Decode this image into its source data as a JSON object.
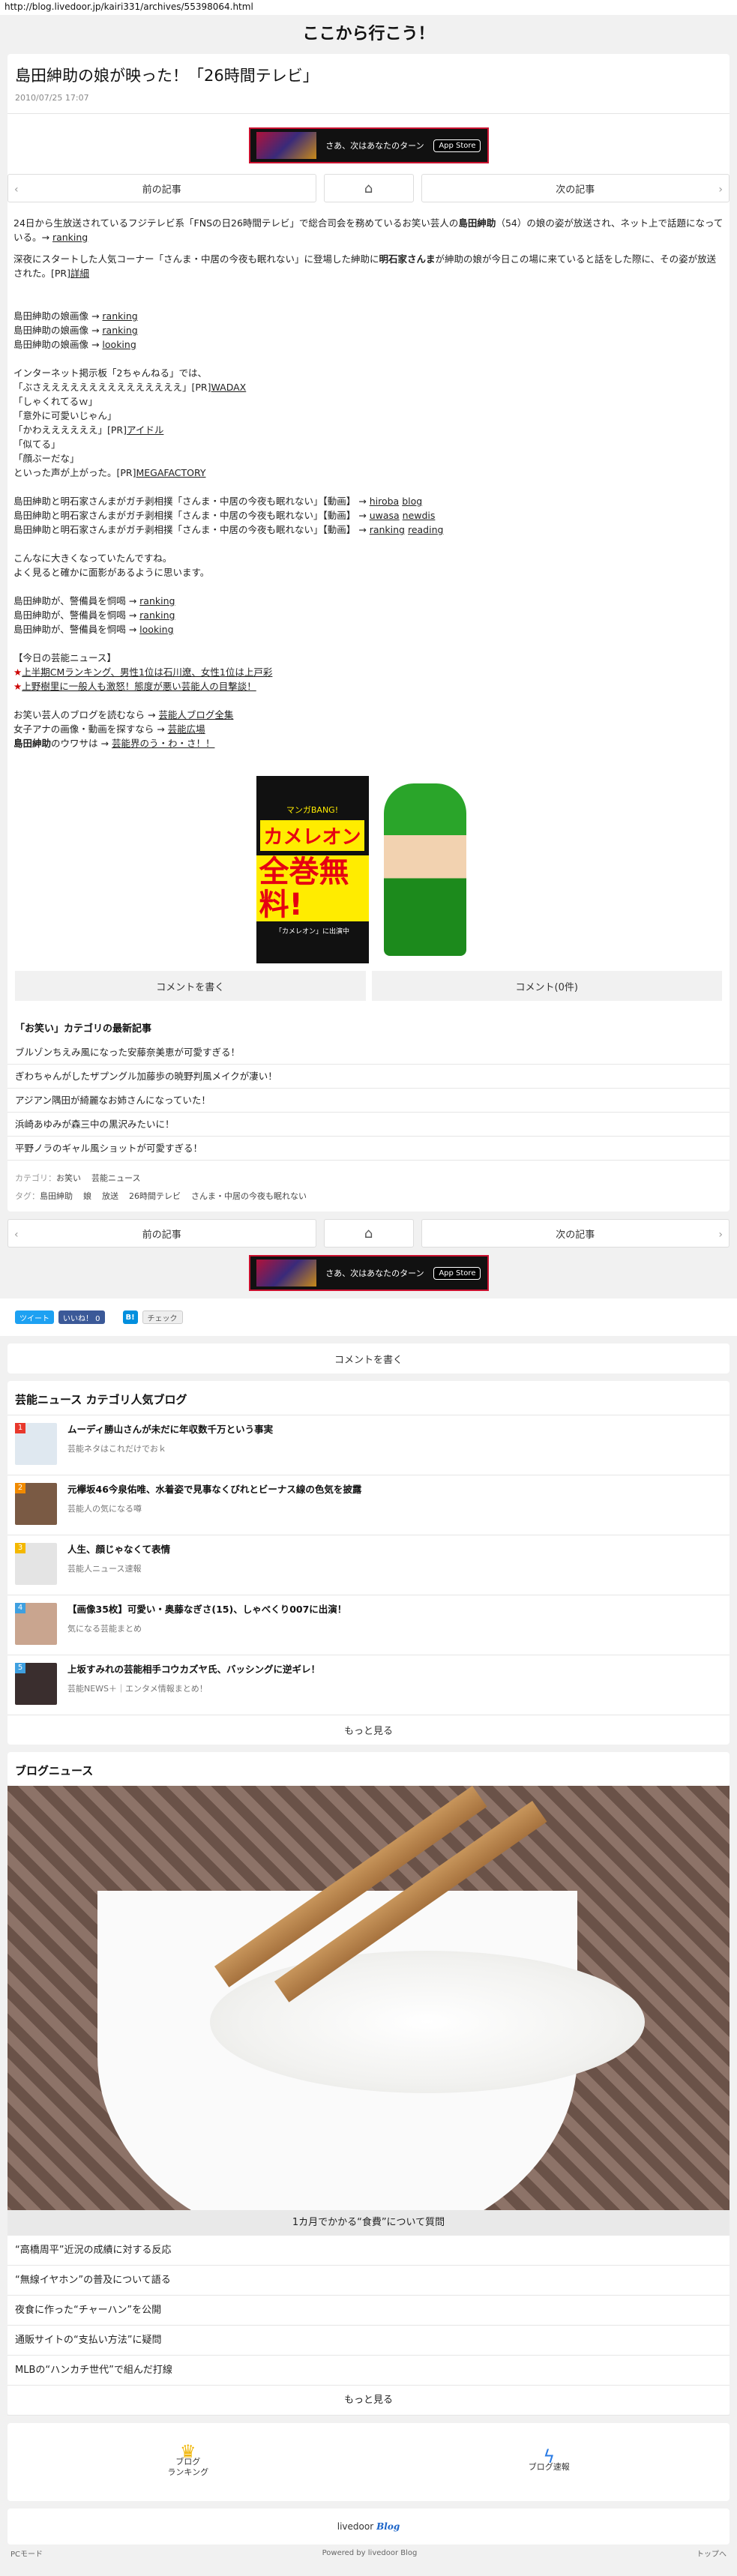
{
  "browser": {
    "url": "http://blog.livedoor.jp/kairi331/archives/55398064.html"
  },
  "site": {
    "title": "ここから行こう！"
  },
  "article": {
    "title": "島田紳助の娘が映った！「26時間テレビ」",
    "date": "2010/07/25 17:07"
  },
  "banner": {
    "text": "さあ、次はあなたのターン",
    "store": "App Store"
  },
  "pager": {
    "prev": "前の記事",
    "next": "次の記事"
  },
  "body": {
    "p1a": "24日から生放送されているフジテレビ系「FNSの日26時間テレビ」で総合司会を務めているお笑い芸人の",
    "p1b": "島田紳助",
    "p1c": "（54）の娘の姿が放送され、ネット上で話題になっている。→ ",
    "p1link": "ranking",
    "p2a": "深夜にスタートした人気コーナー「さんま・中居の今夜も眠れない」に登場した紳助に",
    "p2b": "明石家さんま",
    "p2c": "が紳助の娘が今日この場に来ていると話をした際に、その姿が放送された。[PR]",
    "p2link": "詳細",
    "img1": "島田紳助の娘画像 → ",
    "img1link": "ranking",
    "img2": "島田紳助の娘画像 → ",
    "img2link": "ranking",
    "img3": "島田紳助の娘画像 → ",
    "img3link": "looking",
    "net1": "インターネット掲示板「2ちゃんねる」では、",
    "net2a": "「ぶさえええええええええええええええ」[PR]",
    "net2link": "WADAX",
    "net3": "「しゃくれてるｗ」",
    "net4": "「意外に可愛いじゃん」",
    "net5a": "「かわええええええ」[PR]",
    "net5link": "アイドル",
    "net6": "「似てる」",
    "net7": "「顔ぶーだな」",
    "net8a": "といった声が上がった。[PR]",
    "net8link": "MEGAFACTORY",
    "v1": "島田紳助と明石家さんまがガチ剥相撲「さんま・中居の今夜も眠れない」【動画】 → ",
    "v1linkA": "hiroba",
    "v1linkB": "blog",
    "v2": "島田紳助と明石家さんまがガチ剥相撲「さんま・中居の今夜も眠れない」【動画】 → ",
    "v2linkA": "uwasa",
    "v2linkB": "newdis",
    "v3": "島田紳助と明石家さんまがガチ剥相撲「さんま・中居の今夜も眠れない」【動画】 → ",
    "v3linkA": "ranking",
    "v3linkB": "reading",
    "c1": "こんなに大きくなっていたんですね。",
    "c2": "よく見ると確かに面影があるように思います。",
    "g1": "島田紳助が、警備員を恫喝 → ",
    "g1link": "ranking",
    "g2": "島田紳助が、警備員を恫喝 → ",
    "g2link": "ranking",
    "g3": "島田紳助が、警備員を恫喝 → ",
    "g3link": "looking",
    "today_head": "【今日の芸能ニュース】",
    "today1": "上半期CMランキング、男性1位は石川遼、女性1位は上戸彩",
    "today2": "上野樹里に一般人も激怒！態度が悪い芸能人の目撃談！",
    "f1a": "お笑い芸人のブログを読むなら → ",
    "f1link": "芸能人ブログ全集",
    "f2a": "女子アナの画像・動画を探すなら → ",
    "f2link": "芸能広場",
    "f3a": "島田紳助",
    "f3b": "のウワサは → ",
    "f3link": "芸能界のう・わ・さ！！"
  },
  "ad": {
    "line1": "マンガBANG!",
    "line2": "カメレオン",
    "line3": "全巻無料!",
    "line4": "「カメレオン」に出演中"
  },
  "actions": {
    "comment_write": "コメントを書く",
    "comment_count": "コメント(0件)"
  },
  "category": {
    "heading": "「お笑い」カテゴリの最新記事",
    "items": [
      "ブルゾンちえみ風になった安藤奈美恵が可愛すぎる！",
      "ぎわちゃんがしたザプングル加藤歩の暁野判風メイクが凄い！",
      "アジアン隅田が綺麗なお姉さんになっていた！",
      "浜崎あゆみが森三中の黒沢みたいに！",
      "平野ノラのギャル風ショットが可愛すぎる！"
    ]
  },
  "tags": {
    "cat_label": "カテゴリ：",
    "cat1": "お笑い",
    "cat2": "芸能ニュース",
    "tag_label": "タグ：",
    "t1": "島田紳助",
    "t2": "娘",
    "t3": "放送",
    "t4": "26時間テレビ",
    "t5": "さんま・中居の今夜も眠れない"
  },
  "share": {
    "tweet": "ツイート",
    "like": "いいね！ 0",
    "hatena": "B!",
    "check": "チェック"
  },
  "ranking": {
    "heading": "芸能ニュース カテゴリ人気ブログ",
    "items": [
      {
        "num": "1",
        "title": "ムーディ勝山さんが未だに年収数千万という事実",
        "sub": "芸能ネタはこれだけでおｋ"
      },
      {
        "num": "2",
        "title": "元欅坂46今泉佑唯、水着姿で見事なくびれとビーナス線の色気を披露",
        "sub": "芸能人の気になる噂"
      },
      {
        "num": "3",
        "title": "人生、顔じゃなくて表情",
        "sub": "芸能人ニュース速報"
      },
      {
        "num": "4",
        "title": "【画像35枚】可愛い・奥藤なぎさ(15)、しゃべくり007に出演！",
        "sub": "気になる芸能まとめ"
      },
      {
        "num": "5",
        "title": "上坂すみれの芸能相手コウカズヤ氏、バッシングに逆ギレ！",
        "sub": "芸能NEWS＋｜エンタメ情報まとめ！"
      }
    ],
    "more": "もっと見る"
  },
  "news": {
    "heading": "ブログニュース",
    "caption": "1カ月でかかる“食費”について質問",
    "items": [
      "“高橋周平”近況の成績に対する反応",
      "“無線イヤホン”の普及について語る",
      "夜食に作った“チャーハン”を公開",
      "通販サイトの“支払い方法”に疑問",
      "MLBの“ハンカチ世代”で組んだ打線"
    ],
    "more": "もっと見る"
  },
  "footer": {
    "blog_ranking1": "ブログ",
    "blog_ranking2": "ランキング",
    "blog_news": "ブログ速報",
    "brand_livedoor": "livedoor",
    "brand_blog": "Blog",
    "pc_mode": "PCモード",
    "powered": "Powered by livedoor Blog",
    "top": "トップへ"
  }
}
